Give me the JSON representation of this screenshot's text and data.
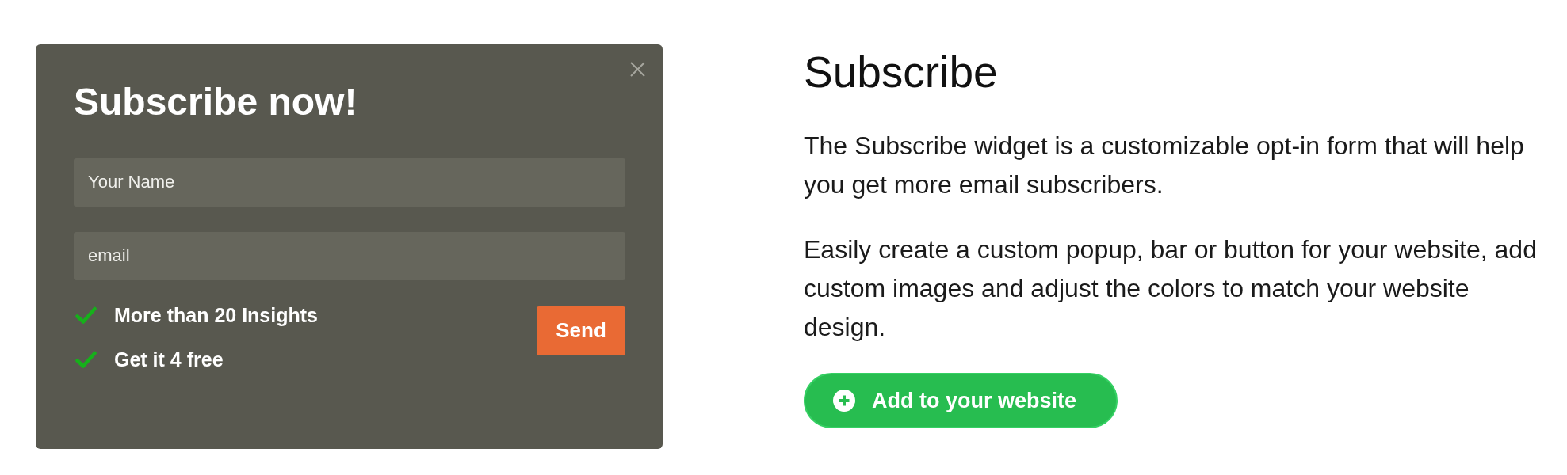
{
  "popup": {
    "title": "Subscribe now!",
    "fields": [
      {
        "placeholder": "Your Name"
      },
      {
        "placeholder": "email"
      }
    ],
    "benefits": [
      "More than 20 Insights",
      "Get it 4 free"
    ],
    "send_button": "Send"
  },
  "info": {
    "heading": "Subscribe",
    "paragraphs": [
      "The Subscribe widget is a customizable opt-in form that will help you get more email subscribers.",
      "Easily create a custom popup, bar or button for your website, add custom images and adjust the colors to match your website design."
    ],
    "button": "Add to your website"
  }
}
